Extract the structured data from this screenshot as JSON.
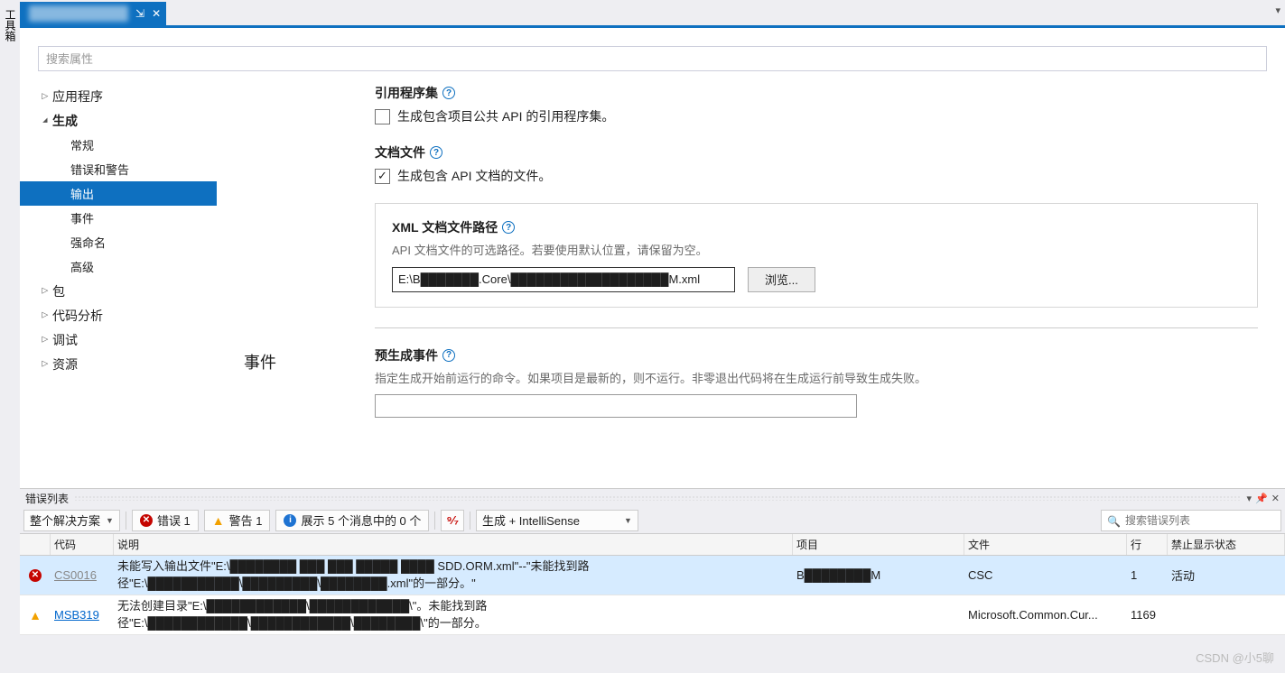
{
  "toolbox_label": "工具箱",
  "tab": {
    "pin_tooltip": "固定",
    "close_tooltip": "关闭"
  },
  "search_placeholder": "搜索属性",
  "nav": {
    "items": [
      {
        "label": "应用程序",
        "expander": "right",
        "bold": false
      },
      {
        "label": "生成",
        "expander": "down",
        "bold": true
      },
      {
        "label": "常规",
        "sub": true
      },
      {
        "label": "错误和警告",
        "sub": true
      },
      {
        "label": "输出",
        "sub": true,
        "selected": true
      },
      {
        "label": "事件",
        "sub": true
      },
      {
        "label": "强命名",
        "sub": true
      },
      {
        "label": "高级",
        "sub": true
      },
      {
        "label": "包",
        "expander": "right"
      },
      {
        "label": "代码分析",
        "expander": "right"
      },
      {
        "label": "调试",
        "expander": "right"
      },
      {
        "label": "资源",
        "expander": "right"
      }
    ]
  },
  "output": {
    "ref_assembly": {
      "title": "引用程序集",
      "chk_label": "生成包含项目公共 API 的引用程序集。",
      "checked": false
    },
    "doc_file": {
      "title": "文档文件",
      "chk_label": "生成包含 API 文档的文件。",
      "checked": true
    },
    "xml_path": {
      "title": "XML 文档文件路径",
      "hint": "API 文档文件的可选路径。若要使用默认位置，请保留为空。",
      "value": "E:\\B███████.Core\\███████████████████M.xml",
      "browse": "浏览..."
    }
  },
  "events": {
    "heading": "事件",
    "pre_build": {
      "title": "预生成事件",
      "hint": "指定生成开始前运行的命令。如果项目是最新的，则不运行。非零退出代码将在生成运行前导致生成失败。"
    }
  },
  "errorlist": {
    "title": "错误列表",
    "scope": "整个解决方案",
    "errors_label": "错误 1",
    "warnings_label": "警告 1",
    "info_label": "展示 5 个消息中的 0 个",
    "source_label": "生成 + IntelliSense",
    "search_placeholder": "搜索错误列表",
    "columns": {
      "code": "代码",
      "desc": "说明",
      "proj": "项目",
      "file": "文件",
      "line": "行",
      "suppress": "禁止显示状态"
    },
    "rows": [
      {
        "type": "error",
        "code": "CS0016",
        "code_muted": true,
        "desc": "未能写入输出文件\"E:\\████████ ███ ███ █████ ████ SDD.ORM.xml\"--\"未能找到路径\"E:\\███████████\\█████████\\████████.xml\"的一部分。\"",
        "proj": "B████████M",
        "file": "CSC",
        "line": "1",
        "suppress": "活动"
      },
      {
        "type": "warning",
        "code": "MSB319",
        "code_muted": false,
        "desc": "无法创建目录\"E:\\████████████\\████████████\\\"。未能找到路径\"E:\\████████████\\████████████\\████████\\\"的一部分。",
        "proj": "",
        "file": "Microsoft.Common.Cur...",
        "line": "1169",
        "suppress": ""
      }
    ]
  },
  "watermark": "CSDN @小5聊"
}
